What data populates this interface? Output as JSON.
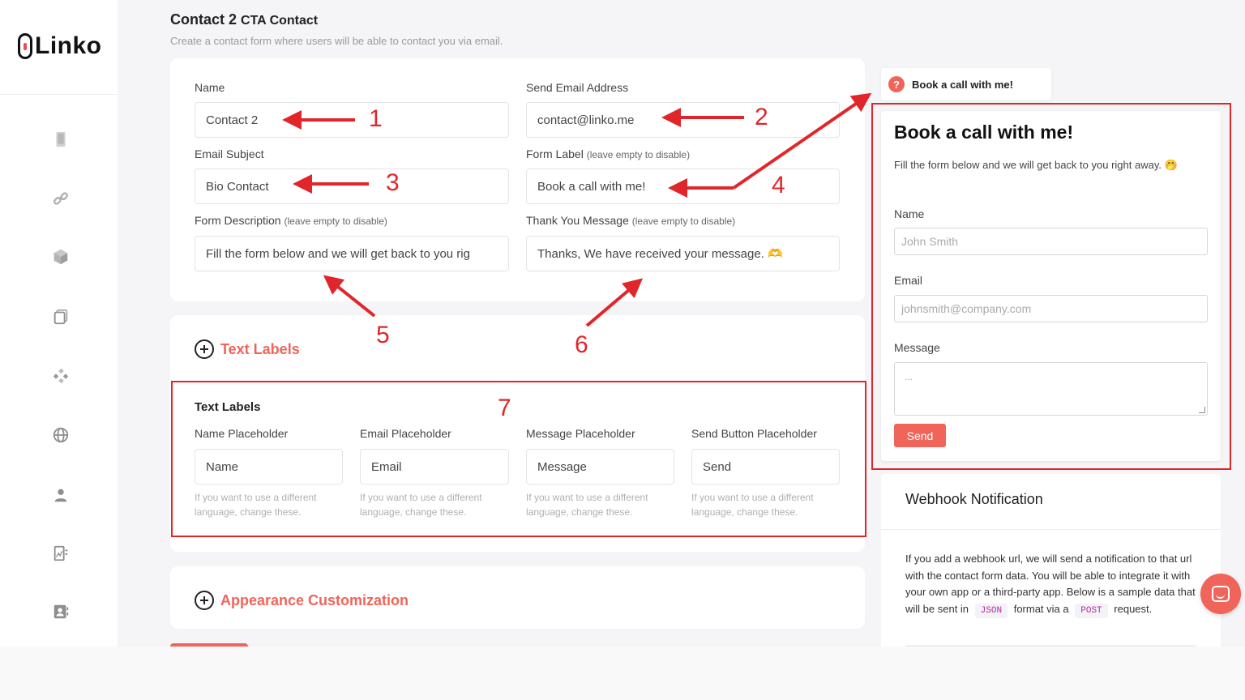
{
  "app": {
    "logo_text": "Linko",
    "nav_icons": [
      "phone-icon",
      "link-icon",
      "cube-icon",
      "copy-icon",
      "components-icon",
      "globe-icon",
      "user-icon",
      "analytics-icon",
      "contacts-icon"
    ]
  },
  "header": {
    "title": "Contact 2",
    "title_suffix": "CTA Contact",
    "subtitle": "Create a contact form where users will be able to contact you via email."
  },
  "form": {
    "name": {
      "label": "Name",
      "value": "Contact 2"
    },
    "send_email": {
      "label": "Send Email Address",
      "value": "contact@linko.me"
    },
    "email_subject": {
      "label": "Email Subject",
      "value": "Bio Contact"
    },
    "form_label": {
      "label": "Form Label",
      "hint": "(leave empty to disable)",
      "value": "Book a call with me!"
    },
    "form_description": {
      "label": "Form Description",
      "hint": "(leave empty to disable)",
      "value": "Fill the form below and we will get back to you rig"
    },
    "thank_you": {
      "label": "Thank You Message",
      "hint": "(leave empty to disable)",
      "value": "Thanks, We have received your message. 🫶"
    }
  },
  "text_labels_toggle": "Text Labels",
  "text_labels": {
    "title": "Text Labels",
    "fields": [
      {
        "label": "Name Placeholder",
        "value": "Name",
        "help": "If you want to use a different language, change these."
      },
      {
        "label": "Email Placeholder",
        "value": "Email",
        "help": "If you want to use a different language, change these."
      },
      {
        "label": "Message Placeholder",
        "value": "Message",
        "help": "If you want to use a different language, change these."
      },
      {
        "label": "Send Button Placeholder",
        "value": "Send",
        "help": "If you want to use a different language, change these."
      }
    ]
  },
  "appearance_toggle": "Appearance Customization",
  "annotations": [
    "1",
    "2",
    "3",
    "4",
    "5",
    "6",
    "7"
  ],
  "preview": {
    "tab_icon": "?",
    "tab_label": "Book a call with me!",
    "title": "Book a call with me!",
    "description": "Fill the form below and we will get back to you right away. 🤭",
    "name_label": "Name",
    "name_placeholder": "John Smith",
    "email_label": "Email",
    "email_placeholder": "johnsmith@company.com",
    "message_label": "Message",
    "message_placeholder": "...",
    "send_label": "Send"
  },
  "webhook": {
    "title": "Webhook Notification",
    "text_before": "If you add a webhook url, we will send a notification to that url with the contact form data. You will be able to integrate it with your own app or a third-party app. Below is a sample data that will be sent in",
    "json_chip": "JSON",
    "text_middle": "format via a",
    "post_chip": "POST",
    "text_after": "request."
  },
  "colors": {
    "accent": "#f0645a",
    "annotation_red": "#e0262a"
  }
}
